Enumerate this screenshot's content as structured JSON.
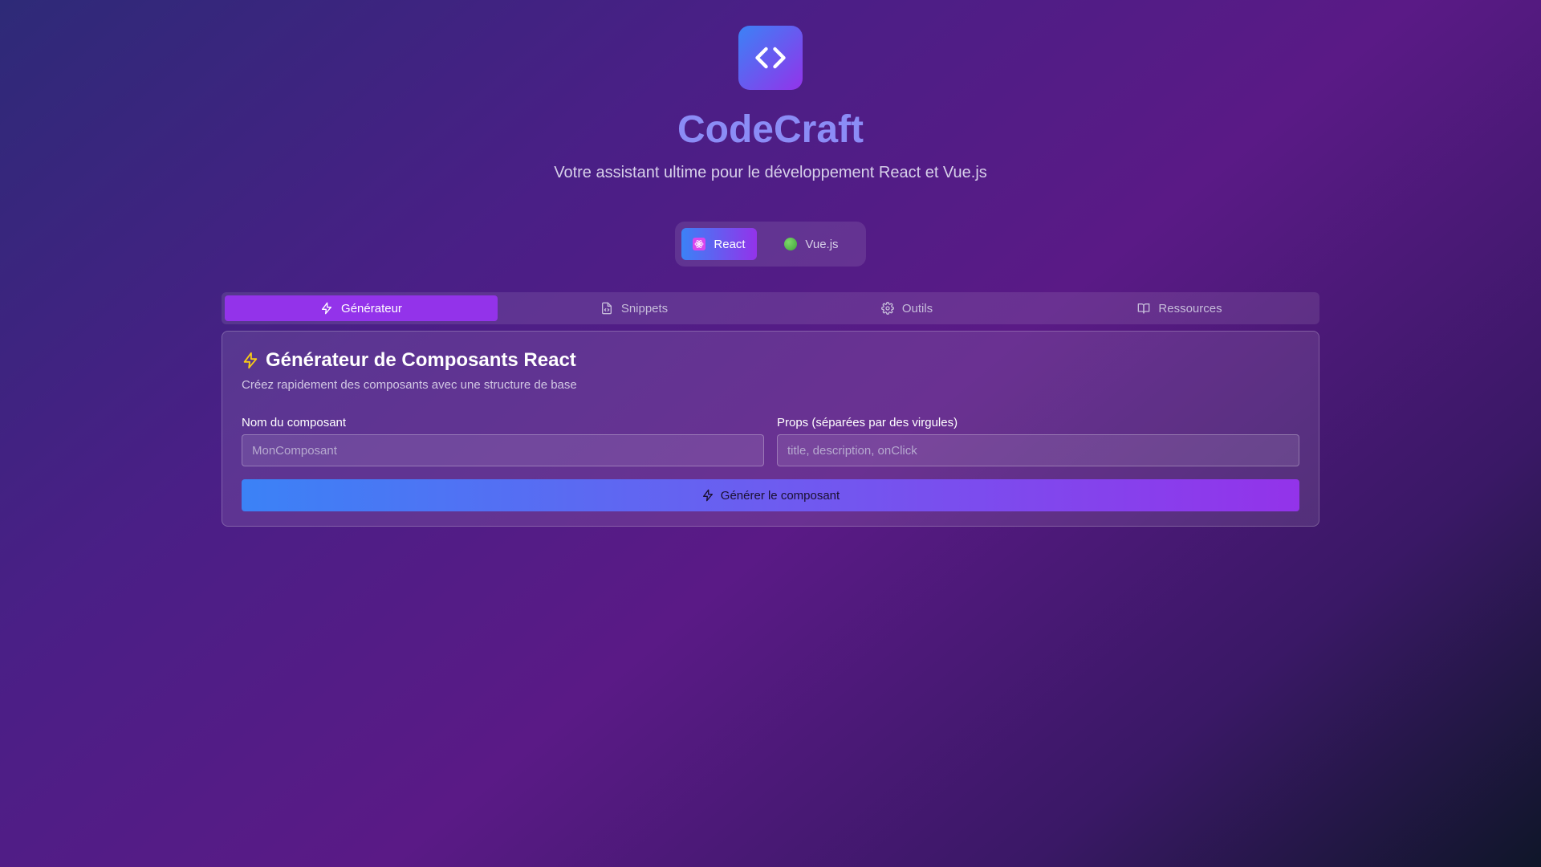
{
  "header": {
    "logo_icon": "code-brackets-icon",
    "title": "CodeCraft",
    "subtitle": "Votre assistant ultime pour le développement React et Vue.js"
  },
  "framework_switch": {
    "options": [
      {
        "label": "React",
        "icon": "react-icon",
        "selected": true
      },
      {
        "label": "Vue.js",
        "icon": "vue-icon",
        "selected": false
      }
    ]
  },
  "tabs": [
    {
      "label": "Générateur",
      "icon": "bolt-icon",
      "active": true
    },
    {
      "label": "Snippets",
      "icon": "file-code-icon",
      "active": false
    },
    {
      "label": "Outils",
      "icon": "gear-icon",
      "active": false
    },
    {
      "label": "Ressources",
      "icon": "book-open-icon",
      "active": false
    }
  ],
  "generator": {
    "title": "Générateur de Composants React",
    "subtitle": "Créez rapidement des composants avec une structure de base",
    "name_field": {
      "label": "Nom du composant",
      "value": "",
      "placeholder": "MonComposant"
    },
    "props_field": {
      "label": "Props (séparées par des virgules)",
      "value": "",
      "placeholder": "title, description, onClick"
    },
    "generate_button": "Générer le composant"
  },
  "colors": {
    "accent_purple": "#9333ea",
    "accent_blue": "#3b82f6",
    "title_color": "#8b8cf6",
    "bolt_yellow": "#facc15"
  }
}
